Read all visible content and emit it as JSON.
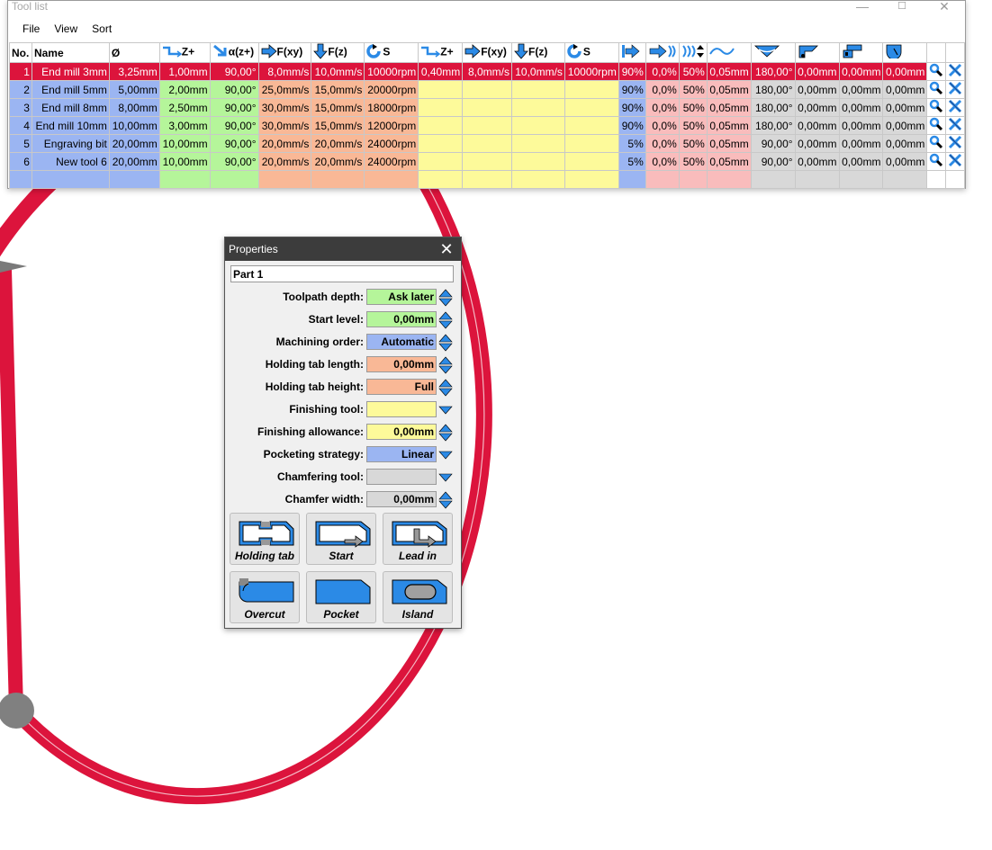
{
  "window": {
    "title": "Tool list",
    "controls": {
      "minimize": "—",
      "maximize": "☐",
      "close": "✕"
    }
  },
  "menu": [
    "File",
    "View",
    "Sort"
  ],
  "table": {
    "headers": [
      {
        "label": "No.",
        "icon": null
      },
      {
        "label": "Name",
        "icon": null
      },
      {
        "label": "Ø",
        "icon": null
      },
      {
        "label": "Z+",
        "icon": "step-down-icon"
      },
      {
        "label": "α(z+)",
        "icon": "angle-arrow-icon"
      },
      {
        "label": "F(xy)",
        "icon": "arrow-right-icon"
      },
      {
        "label": "F(z)",
        "icon": "arrow-down-icon"
      },
      {
        "label": "S",
        "icon": "spindle-rotation-icon"
      },
      {
        "label": "Z+",
        "icon": "step-down-icon"
      },
      {
        "label": "F(xy)",
        "icon": "arrow-right-icon"
      },
      {
        "label": "F(z)",
        "icon": "arrow-down-icon"
      },
      {
        "label": "S",
        "icon": "spindle-rotation-icon"
      },
      {
        "label": "",
        "icon": "stepover-icon"
      },
      {
        "label": "",
        "icon": "overlap-icon"
      },
      {
        "label": "",
        "icon": "ramp-icon"
      },
      {
        "label": "",
        "icon": "wave-icon"
      },
      {
        "label": "",
        "icon": "chamfer-angle-icon"
      },
      {
        "label": "",
        "icon": "tool-offset-icon"
      },
      {
        "label": "",
        "icon": "tool-length-icon"
      },
      {
        "label": "",
        "icon": "tool-radius-icon"
      },
      {
        "label": "",
        "icon": null
      },
      {
        "label": "",
        "icon": null
      }
    ],
    "rows": [
      {
        "no": "1",
        "name": "End mill 3mm",
        "dia": "3,25mm",
        "z": "1,00mm",
        "alpha": "90,00°",
        "fxy": "8,0mm/s",
        "fz": "10,0mm/s",
        "s": "10000rpm",
        "z2": "0,40mm",
        "fxy2": "8,0mm/s",
        "fz2": "10,0mm/s",
        "s2": "10000rpm",
        "p1": "90%",
        "p2": "0,0%",
        "p3": "50%",
        "p4": "0,05mm",
        "g1": "180,00°",
        "g2": "0,00mm",
        "g3": "0,00mm",
        "g4": "0,00mm"
      },
      {
        "no": "2",
        "name": "End mill 5mm",
        "dia": "5,00mm",
        "z": "2,00mm",
        "alpha": "90,00°",
        "fxy": "25,0mm/s",
        "fz": "15,0mm/s",
        "s": "20000rpm",
        "z2": "",
        "fxy2": "",
        "fz2": "",
        "s2": "",
        "p1": "90%",
        "p2": "0,0%",
        "p3": "50%",
        "p4": "0,05mm",
        "g1": "180,00°",
        "g2": "0,00mm",
        "g3": "0,00mm",
        "g4": "0,00mm"
      },
      {
        "no": "3",
        "name": "End mill 8mm",
        "dia": "8,00mm",
        "z": "2,50mm",
        "alpha": "90,00°",
        "fxy": "30,0mm/s",
        "fz": "15,0mm/s",
        "s": "18000rpm",
        "z2": "",
        "fxy2": "",
        "fz2": "",
        "s2": "",
        "p1": "90%",
        "p2": "0,0%",
        "p3": "50%",
        "p4": "0,05mm",
        "g1": "180,00°",
        "g2": "0,00mm",
        "g3": "0,00mm",
        "g4": "0,00mm"
      },
      {
        "no": "4",
        "name": "End mill 10mm",
        "dia": "10,00mm",
        "z": "3,00mm",
        "alpha": "90,00°",
        "fxy": "30,0mm/s",
        "fz": "15,0mm/s",
        "s": "12000rpm",
        "z2": "",
        "fxy2": "",
        "fz2": "",
        "s2": "",
        "p1": "90%",
        "p2": "0,0%",
        "p3": "50%",
        "p4": "0,05mm",
        "g1": "180,00°",
        "g2": "0,00mm",
        "g3": "0,00mm",
        "g4": "0,00mm"
      },
      {
        "no": "5",
        "name": "Engraving bit",
        "dia": "20,00mm",
        "z": "10,00mm",
        "alpha": "90,00°",
        "fxy": "20,0mm/s",
        "fz": "20,0mm/s",
        "s": "24000rpm",
        "z2": "",
        "fxy2": "",
        "fz2": "",
        "s2": "",
        "p1": "5%",
        "p2": "0,0%",
        "p3": "50%",
        "p4": "0,05mm",
        "g1": "90,00°",
        "g2": "0,00mm",
        "g3": "0,00mm",
        "g4": "0,00mm"
      },
      {
        "no": "6",
        "name": "New tool 6",
        "dia": "20,00mm",
        "z": "10,00mm",
        "alpha": "90,00°",
        "fxy": "20,0mm/s",
        "fz": "20,0mm/s",
        "s": "24000rpm",
        "z2": "",
        "fxy2": "",
        "fz2": "",
        "s2": "",
        "p1": "5%",
        "p2": "0,0%",
        "p3": "50%",
        "p4": "0,05mm",
        "g1": "90,00°",
        "g2": "0,00mm",
        "g3": "0,00mm",
        "g4": "0,00mm"
      }
    ],
    "selected_row": 0
  },
  "properties": {
    "title": "Properties",
    "close": "✕",
    "part_name": "Part 1",
    "fields": [
      {
        "label": "Toolpath depth:",
        "value": "Ask later",
        "color": "#b5f59a",
        "control": "spin"
      },
      {
        "label": "Start level:",
        "value": "0,00mm",
        "color": "#b5f59a",
        "control": "spin"
      },
      {
        "label": "Machining order:",
        "value": "Automatic",
        "color": "#9bb5f2",
        "control": "spin"
      },
      {
        "label": "Holding tab length:",
        "value": "0,00mm",
        "color": "#f9b896",
        "control": "spin"
      },
      {
        "label": "Holding tab height:",
        "value": "Full",
        "color": "#f9b896",
        "control": "spin"
      },
      {
        "label": "Finishing tool:",
        "value": "",
        "color": "#fdfa9a",
        "control": "dropdown"
      },
      {
        "label": "Finishing allowance:",
        "value": "0,00mm",
        "color": "#fdfa9a",
        "control": "spin"
      },
      {
        "label": "Pocketing strategy:",
        "value": "Linear",
        "color": "#9bb5f2",
        "control": "dropdown"
      },
      {
        "label": "Chamfering tool:",
        "value": "",
        "color": "#d8d8d8",
        "control": "dropdown"
      },
      {
        "label": "Chamfer width:",
        "value": "0,00mm",
        "color": "#d8d8d8",
        "control": "spin"
      }
    ],
    "buttons": [
      {
        "label": "Holding tab",
        "icon": "holding-tab-icon"
      },
      {
        "label": "Start",
        "icon": "start-icon"
      },
      {
        "label": "Lead in",
        "icon": "lead-in-icon"
      },
      {
        "label": "Overcut",
        "icon": "overcut-icon"
      },
      {
        "label": "Pocket",
        "icon": "pocket-icon"
      },
      {
        "label": "Island",
        "icon": "island-icon"
      }
    ]
  },
  "colors": {
    "selection": "#dc143c",
    "accent_blue": "#2b8ae6",
    "contour": "#dc143c"
  }
}
